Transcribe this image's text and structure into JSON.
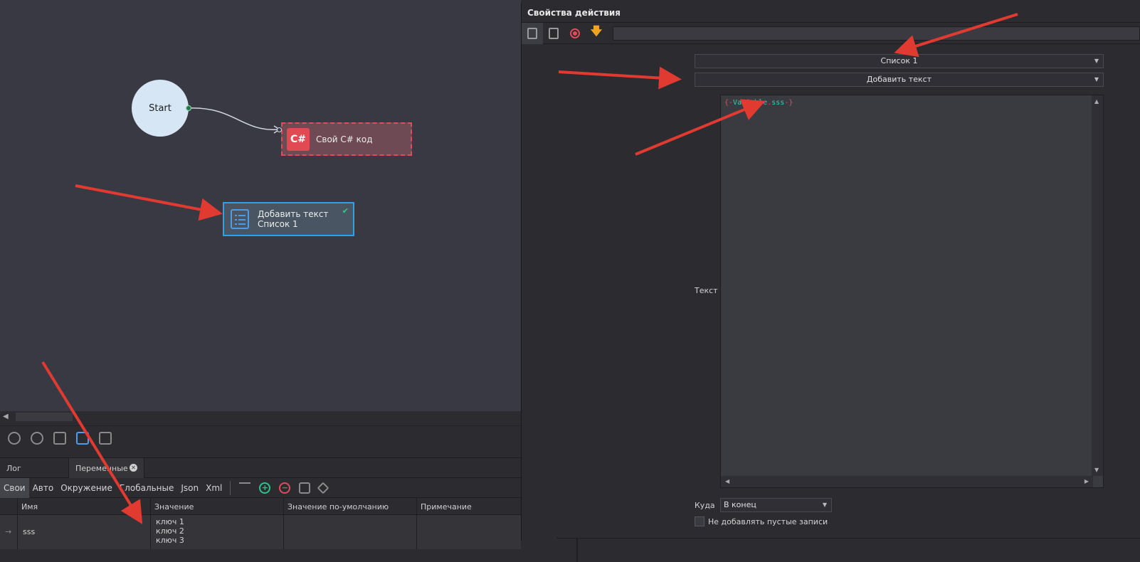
{
  "canvas": {
    "start_label": "Start",
    "cs_node": {
      "badge": "C#",
      "label": "Свой C# код"
    },
    "add_node": {
      "line1": "Добавить текст",
      "line2": "Список 1",
      "check": "✔"
    }
  },
  "bottom": {
    "tabs": [
      {
        "label": "Лог"
      },
      {
        "label": "Переменные",
        "close": "✕"
      }
    ],
    "var_tabs": [
      "Свои",
      "Авто",
      "Окружение",
      "Глобальные",
      "Json",
      "Xml"
    ],
    "columns": [
      "Имя",
      "Значение",
      "Значение по-умолчанию",
      "Примечание"
    ],
    "rows": [
      {
        "arrow": "→",
        "name": "sss",
        "value_lines": [
          "ключ 1",
          "ключ 2",
          "ключ 3"
        ],
        "default": "",
        "note": ""
      }
    ],
    "add_symbol": "+",
    "remove_symbol": "−"
  },
  "props": {
    "title": "Свойства действия",
    "list_select": "Список 1",
    "action_select": "Добавить текст",
    "text_label": "Текст",
    "code": {
      "open": "{-",
      "var": "Variable",
      "dot": ".",
      "name": "sss",
      "close": "-}"
    },
    "where_label": "Куда",
    "where_value": "В конец",
    "skip_empty_label": "Не добавлять пустые записи"
  },
  "colors": {
    "accent_blue": "#2aa3e8",
    "accent_red": "#e24b5a",
    "accent_green": "#2bc48a",
    "arrow_red": "#e03a31"
  }
}
